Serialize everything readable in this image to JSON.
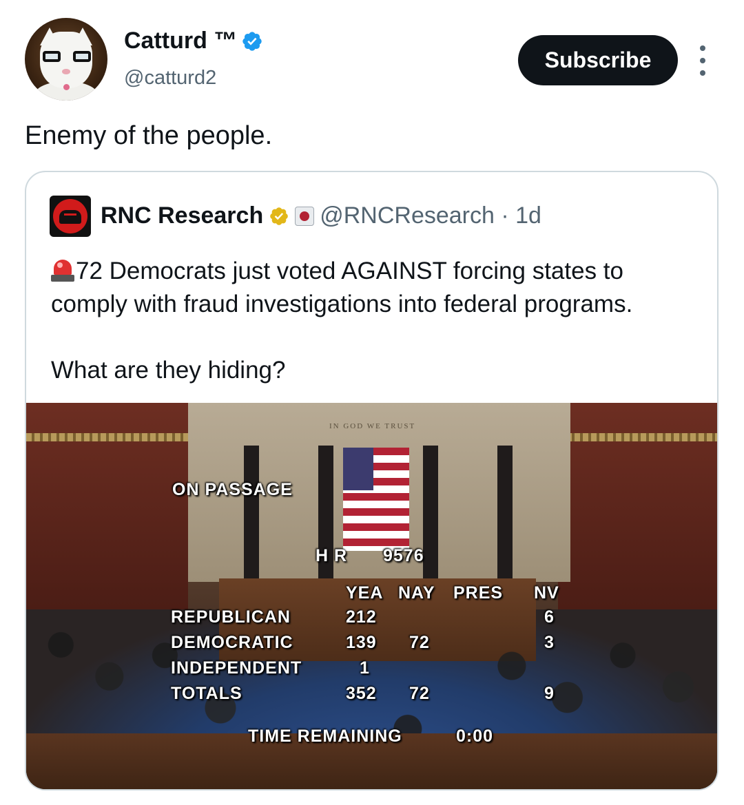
{
  "author": {
    "display_name": "Catturd ™",
    "handle": "@catturd2",
    "verified_icon": "blue-verified-badge-icon"
  },
  "actions": {
    "subscribe_label": "Subscribe",
    "more_icon": "more-vertical-icon"
  },
  "tweet": {
    "text": "Enemy of the people."
  },
  "quoted": {
    "display_name": "RNC Research",
    "handle_time": "@RNCResearch · 1d",
    "badges": [
      "gold-verified-badge-icon",
      "affiliate-badge-icon"
    ],
    "emoji": "rotating-light-icon",
    "line1": "72 Democrats just voted AGAINST forcing states to comply with fraud investigations into federal programs.",
    "line2": "What are they hiding?",
    "image": {
      "motto": "IN GOD WE TRUST",
      "on_passage": "ON PASSAGE",
      "bill_prefix": "H R",
      "bill_number": "9576",
      "col_yea": "YEA",
      "col_nay": "NAY",
      "col_pres": "PRES",
      "col_nv": "NV",
      "rows": [
        {
          "party": "REPUBLICAN",
          "yea": "212",
          "nay": "",
          "nv": "6"
        },
        {
          "party": "DEMOCRATIC",
          "yea": "139",
          "nay": "72",
          "nv": "3"
        },
        {
          "party": "INDEPENDENT",
          "yea": "1",
          "nay": "",
          "nv": ""
        },
        {
          "party": "TOTALS",
          "yea": "352",
          "nay": "72",
          "nv": "9"
        }
      ],
      "time_label": "TIME REMAINING",
      "time_value": "0:00"
    }
  }
}
